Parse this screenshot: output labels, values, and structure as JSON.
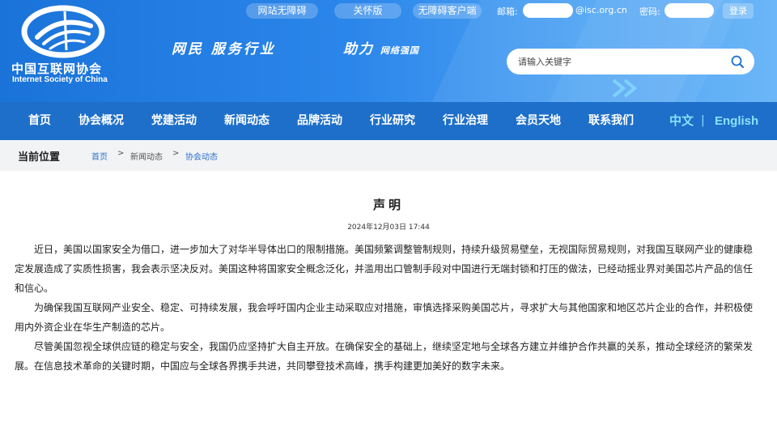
{
  "header": {
    "logo_cn": "中国互联网协会",
    "logo_en": "Internet Society of China",
    "slogan_1": "网民  服务行业",
    "slogan_2_main": "助力",
    "slogan_2_small": "网络强国",
    "top_links": {
      "accessibility": "网站无障碍",
      "care_mode": "关怀版",
      "accessible_client": "无障碍客户端"
    },
    "login": {
      "email_label": "邮箱:",
      "email_domain": "@isc.org.cn",
      "password_label": "密码:",
      "login_button": "登录"
    },
    "search": {
      "placeholder": "请输入关键字"
    }
  },
  "nav": {
    "items": [
      "首页",
      "协会概况",
      "党建活动",
      "新闻动态",
      "品牌活动",
      "行业研究",
      "行业治理",
      "会员天地",
      "联系我们"
    ],
    "lang_cn": "中文",
    "lang_sep": "|",
    "lang_en": "English"
  },
  "breadcrumb": {
    "title": "当前位置",
    "items": [
      "首页",
      "新闻动态",
      "协会动态"
    ],
    "sep": ">"
  },
  "article": {
    "title": "声明",
    "date": "2024年12月03日 17:44",
    "paragraphs": [
      "近日，美国以国家安全为借口，进一步加大了对华半导体出口的限制措施。美国频繁调整管制规则，持续升级贸易壁垒，无视国际贸易规则，对我国互联网产业的健康稳定发展造成了实质性损害，我会表示坚决反对。美国这种将国家安全概念泛化，并滥用出口管制手段对中国进行无端封锁和打压的做法，已经动摇业界对美国芯片产品的信任和信心。",
      "为确保我国互联网产业安全、稳定、可持续发展，我会呼吁国内企业主动采取应对措施，审慎选择采购美国芯片，寻求扩大与其他国家和地区芯片企业的合作，并积极使用内外资企业在华生产制造的芯片。",
      "尽管美国忽视全球供应链的稳定与安全，我国仍应坚持扩大自主开放。在确保安全的基础上，继续坚定地与全球各方建立并维护合作共赢的关系，推动全球经济的繁荣发展。在信息技术革命的关键时期，中国应与全球各界携手共进，共同攀登技术高峰，携手构建更加美好的数字未来。"
    ]
  }
}
